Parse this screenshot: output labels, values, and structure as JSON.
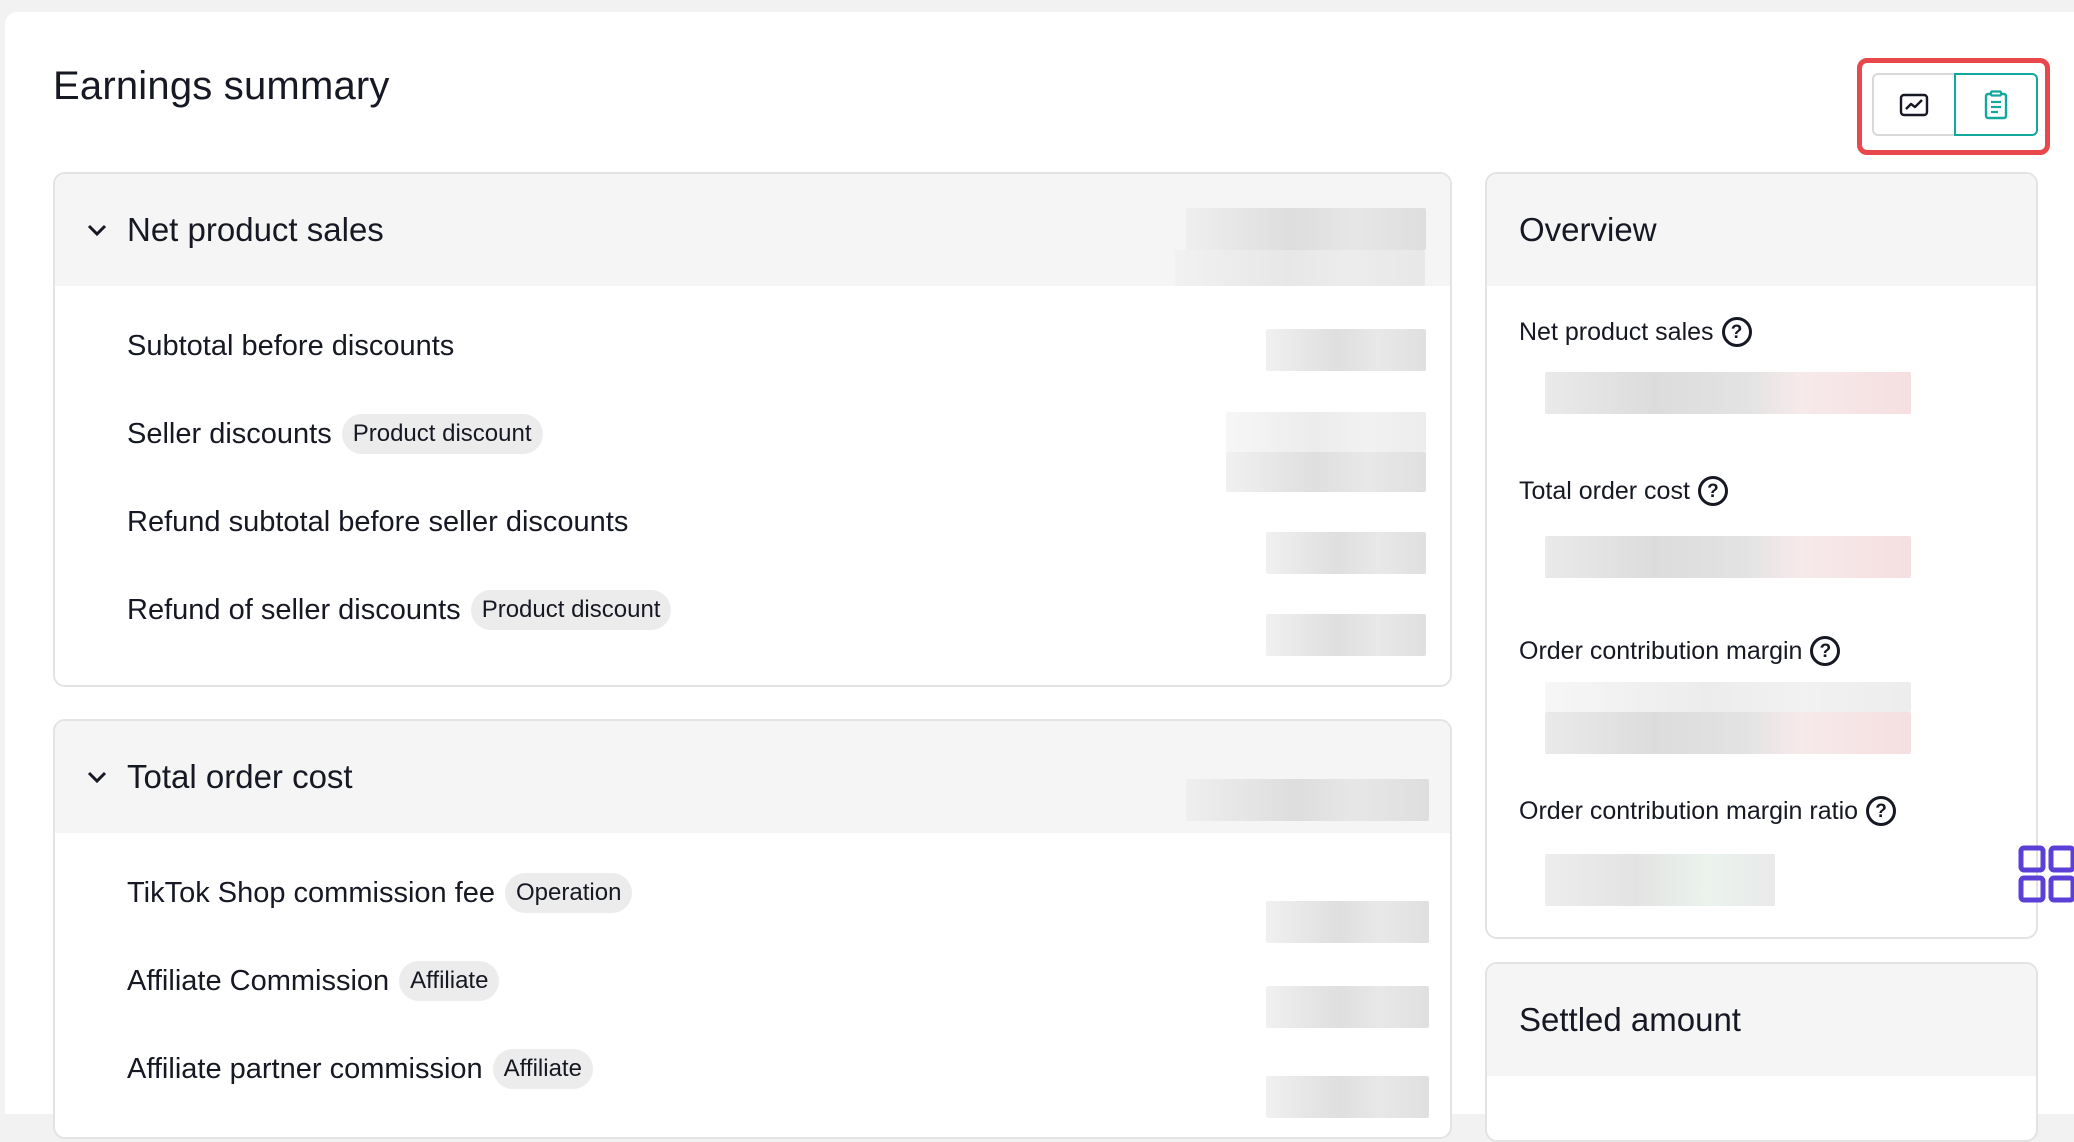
{
  "page": {
    "title": "Earnings summary"
  },
  "view_toggle": {
    "options": [
      {
        "icon": "line-chart-icon",
        "active": false
      },
      {
        "icon": "document-list-icon",
        "active": true
      }
    ],
    "active_color": "#13a89e",
    "highlight_color": "#e8474b"
  },
  "net_product_sales": {
    "title": "Net product sales",
    "rows": [
      {
        "label": "Subtotal before discounts",
        "tag": ""
      },
      {
        "label": "Seller discounts",
        "tag": "Product discount"
      },
      {
        "label": "Refund subtotal before seller discounts",
        "tag": ""
      },
      {
        "label": "Refund of seller discounts",
        "tag": "Product discount"
      }
    ]
  },
  "total_order_cost": {
    "title": "Total order cost",
    "rows": [
      {
        "label": "TikTok Shop commission fee",
        "tag": "Operation"
      },
      {
        "label": "Affiliate Commission",
        "tag": "Affiliate"
      },
      {
        "label": "Affiliate partner commission",
        "tag": "Affiliate"
      }
    ]
  },
  "overview": {
    "title": "Overview",
    "items": [
      {
        "label": "Net product sales"
      },
      {
        "label": "Total order cost"
      },
      {
        "label": "Order contribution margin"
      },
      {
        "label": "Order contribution margin ratio"
      }
    ]
  },
  "settled_amount": {
    "title": "Settled amount"
  },
  "icons": {
    "chevron": "chevron-down-icon",
    "help": "question-circle-icon",
    "widget": "grid-apps-icon"
  },
  "colors": {
    "widget": "#5b3fd6"
  }
}
